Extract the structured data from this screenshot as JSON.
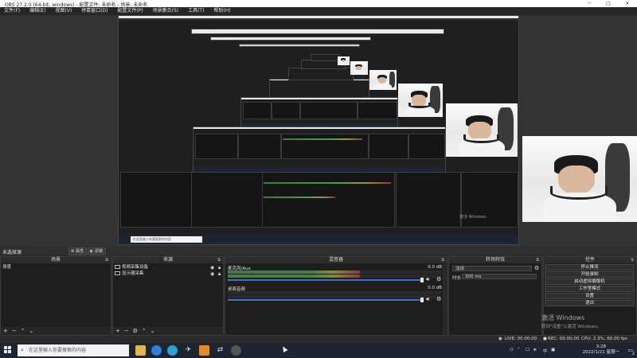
{
  "window": {
    "title": "OBS 27.2.0 (64-bit, windows) - 配置文件: 未命名 - 场景: 未命名",
    "minimize": "─",
    "maximize": "□",
    "close": "✕"
  },
  "menu": [
    "文件(F)",
    "编辑(E)",
    "视图(V)",
    "停靠窗口(D)",
    "配置文件(P)",
    "场景集合(S)",
    "工具(T)",
    "帮助(H)"
  ],
  "preview": {
    "nested_caption": "激活 Windows",
    "nested_caption2": "转到\"设置\"以激活 Windows。",
    "nested_search": "在这里输入你要搜索的内容"
  },
  "status_row": {
    "label": "未选择源",
    "properties_label": "属性",
    "filters_label": "滤镜"
  },
  "scenes": {
    "title": "场景",
    "items": [
      "场景"
    ]
  },
  "sources": {
    "title": "来源",
    "items": [
      {
        "name": "视频采集设备",
        "icon": "camera-icon"
      },
      {
        "name": "显示器采集",
        "icon": "monitor-icon"
      }
    ]
  },
  "mixer": {
    "title": "混音器",
    "channels": [
      {
        "name": "麦克风/Aux",
        "db": "0.0 dB",
        "level": 0.62
      },
      {
        "name": "桌面音频",
        "db": "0.0 dB",
        "level": 0.0
      }
    ]
  },
  "transitions": {
    "title": "转场特效",
    "transition": "淡出",
    "duration_label": "时长",
    "duration_value": "300 ms"
  },
  "controls": {
    "title": "控件",
    "buttons": [
      "停止推流",
      "开始录制",
      "启动虚拟摄像机",
      "工作室模式",
      "设置",
      "退出"
    ]
  },
  "activate_windows": {
    "line1": "激活 Windows",
    "line2": "转到\"设置\"以激活 Windows。"
  },
  "stats": {
    "live": "LIVE: 00:00:00",
    "rec": "REC: 00:00:00",
    "cpu": "CPU: 2.3%, 60.00 fps"
  },
  "taskbar": {
    "search_placeholder": "在这里输入你要搜索的内容",
    "time": "3:28",
    "date": "2022/1/21 星期一",
    "lang": "中",
    "notify_count": "2"
  },
  "colors": {
    "accent": "#3a73c9",
    "panel": "#1e1e1e",
    "taskbar": "#1b2632"
  }
}
